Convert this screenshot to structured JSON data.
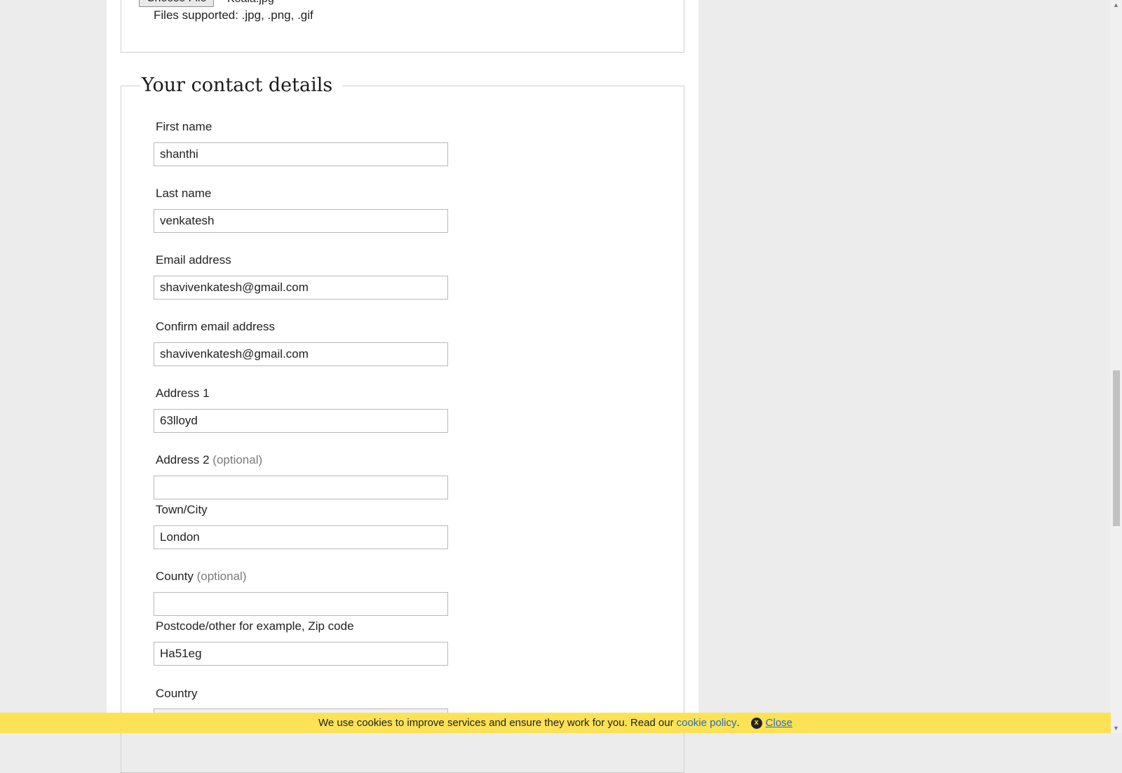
{
  "upload": {
    "button_label": "Choose File",
    "file_name": "Koala.jpg",
    "supported_text": "Files supported: .jpg, .png, .gif"
  },
  "contact": {
    "legend": "Your contact details",
    "optional_suffix": "(optional)",
    "first_name": {
      "label": "First name",
      "value": "shanthi"
    },
    "last_name": {
      "label": "Last name",
      "value": "venkatesh"
    },
    "email": {
      "label": "Email address",
      "value": "shavivenkatesh@gmail.com"
    },
    "confirm_email": {
      "label": "Confirm email address",
      "value": "shavivenkatesh@gmail.com"
    },
    "address1": {
      "label": "Address 1",
      "value": "63lloyd"
    },
    "address2": {
      "label": "Address 2",
      "value": ""
    },
    "town": {
      "label": "Town/City",
      "value": "London"
    },
    "county": {
      "label": "County",
      "value": ""
    },
    "postcode": {
      "label": "Postcode/other for example, Zip code",
      "value": "Ha51eg"
    },
    "country": {
      "label": "Country"
    }
  },
  "cookie_banner": {
    "text": "We use cookies to improve services and ensure they work for you. Read our",
    "link": "cookie policy",
    "period": ".",
    "close": "Close",
    "close_icon_glyph": "x"
  },
  "scrollbar": {
    "up_glyph": "▲",
    "down_glyph": "▼"
  }
}
